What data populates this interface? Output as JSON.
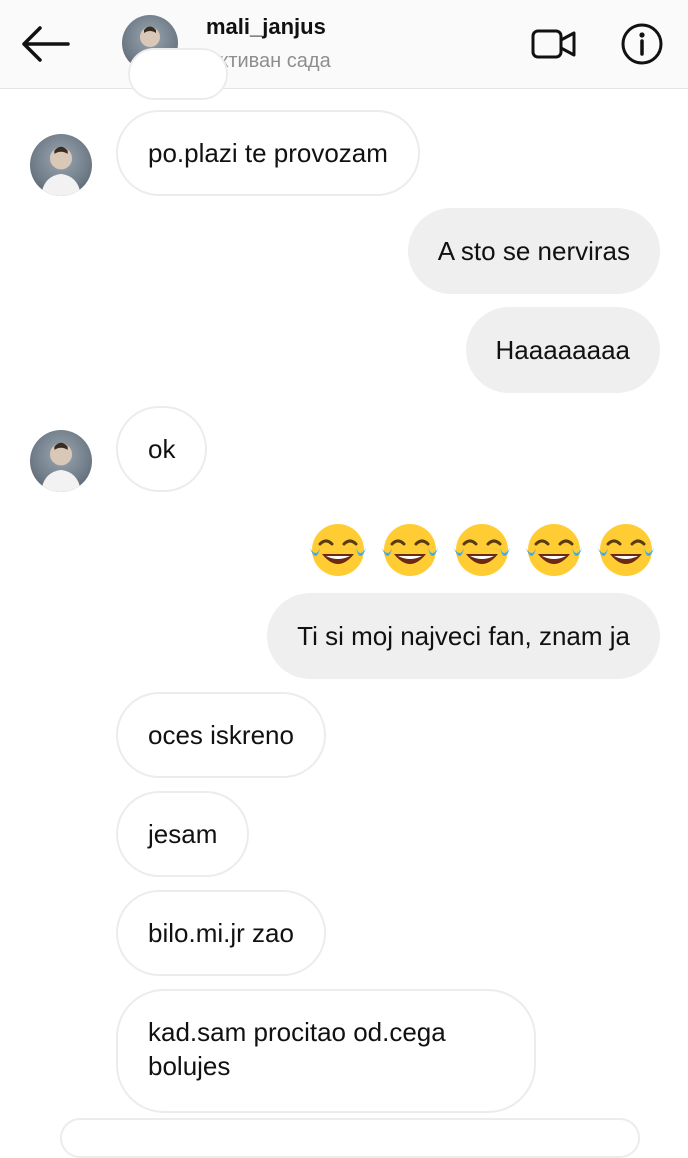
{
  "header": {
    "username": "mali_janjus",
    "status": "Активан сада"
  },
  "icons": {
    "back": "arrow-left-icon",
    "video": "video-camera-icon",
    "info": "info-icon",
    "emoji": "face-with-tears-of-joy"
  },
  "colors": {
    "online": "#4cd137",
    "incoming_bubble": "#ffffff",
    "outgoing_bubble": "#efefef",
    "status_text": "#8e8e8e"
  },
  "messages": [
    {
      "from": "them",
      "text": "po.plazi te provozam"
    },
    {
      "from": "me",
      "text": "A sto se nerviras"
    },
    {
      "from": "me",
      "text": "Haaaaaaaa"
    },
    {
      "from": "them",
      "text": "ok"
    },
    {
      "from": "me",
      "emoji_count": 5
    },
    {
      "from": "me",
      "text": "Ti si moj najveci fan, znam ja"
    },
    {
      "from": "them",
      "text": "oces iskreno"
    },
    {
      "from": "them",
      "text": "jesam"
    },
    {
      "from": "them",
      "text": "bilo.mi.jr zao"
    },
    {
      "from": "them",
      "text_line1": "kad.sam procitao od.cega",
      "text_line2": "bolujes"
    }
  ]
}
